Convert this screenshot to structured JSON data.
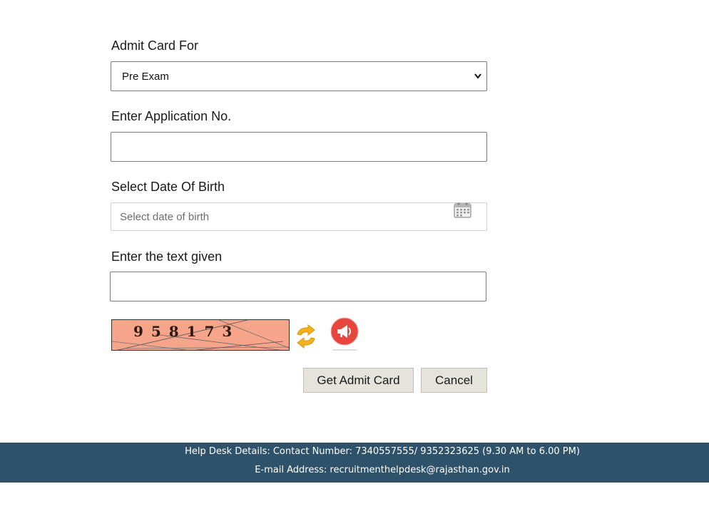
{
  "form": {
    "admit_card_for_label": "Admit Card For",
    "admit_card_for_value": "Pre Exam",
    "application_no_label": "Enter Application No.",
    "application_no_value": "",
    "dob_label": "Select Date Of Birth",
    "dob_placeholder": "Select date of birth",
    "captcha_label": "Enter the text given",
    "captcha_input_value": "",
    "captcha_text": "9 5 8 1 7 3"
  },
  "buttons": {
    "get_admit_card": "Get Admit Card",
    "cancel": "Cancel"
  },
  "footer": {
    "helpdesk": "Help Desk Details: Contact Number: 7340557555/ 9352323625 (9.30 AM to 6.00 PM)",
    "email": "E-mail Address: recruitmenthelpdesk@rajasthan.gov.in"
  },
  "icons": {
    "calendar": "calendar-icon",
    "refresh": "refresh-captcha-icon",
    "audio": "audio-captcha-icon",
    "dropdown": "chevron-down-icon"
  },
  "colors": {
    "footer_bg": "#2d5269",
    "button_bg": "#e6e2dc",
    "captcha_bg": "#f6a48a",
    "audio_icon": "#e8453c",
    "refresh_icon": "#f2b21b"
  }
}
